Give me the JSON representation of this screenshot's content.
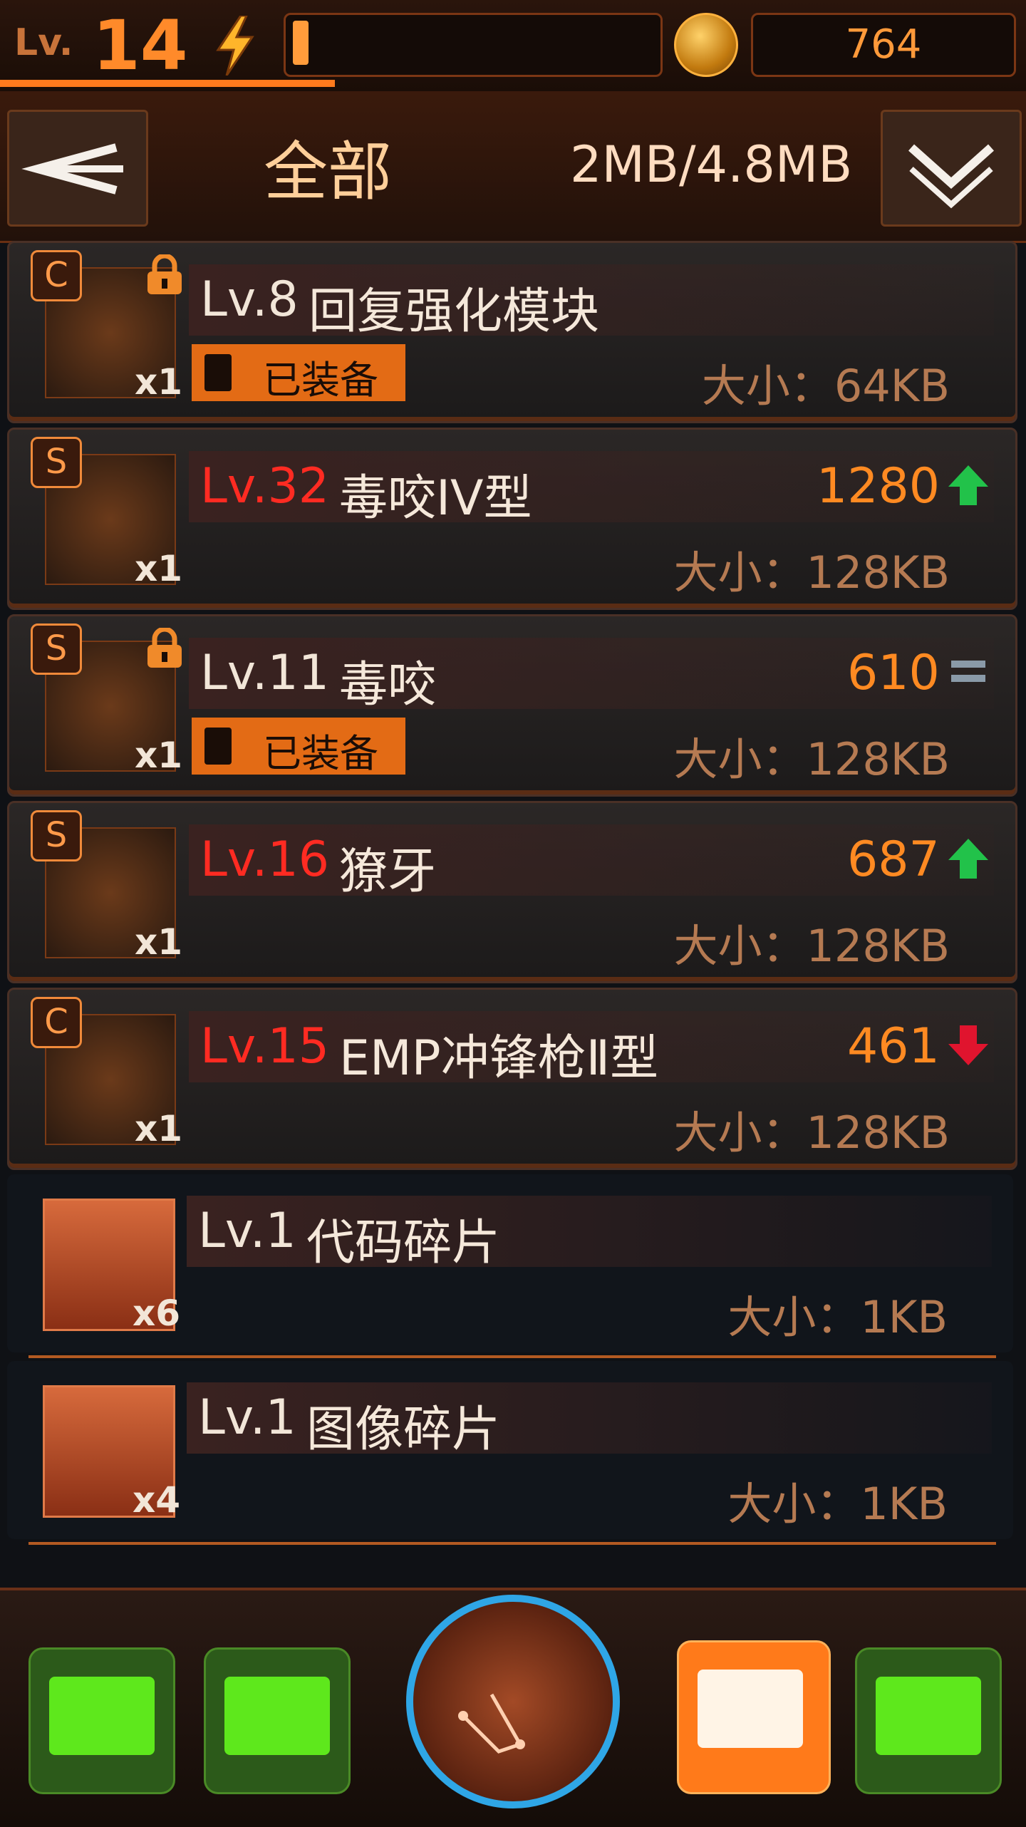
{
  "topbar": {
    "level_label": "Lv.",
    "level_value": "14",
    "energy_fraction": 0.04,
    "coins": "764"
  },
  "header": {
    "filter_title": "全部",
    "capacity": "2MB/4.8MB"
  },
  "items": [
    {
      "grade": "C",
      "locked": true,
      "qty": "x1",
      "level": "Lv.8",
      "level_red": false,
      "name": "回复强化模块",
      "power": "",
      "trend": "",
      "equipped_label": "已装备",
      "size": "大小：64KB"
    },
    {
      "grade": "S",
      "locked": false,
      "qty": "x1",
      "level": "Lv.32",
      "level_red": true,
      "name": "毒咬IV型",
      "power": "1280",
      "trend": "up",
      "equipped_label": "",
      "size": "大小：128KB"
    },
    {
      "grade": "S",
      "locked": true,
      "qty": "x1",
      "level": "Lv.11",
      "level_red": false,
      "name": "毒咬",
      "power": "610",
      "trend": "equal",
      "equipped_label": "已装备",
      "size": "大小：128KB"
    },
    {
      "grade": "S",
      "locked": false,
      "qty": "x1",
      "level": "Lv.16",
      "level_red": true,
      "name": "獠牙",
      "power": "687",
      "trend": "up",
      "equipped_label": "",
      "size": "大小：128KB"
    },
    {
      "grade": "C",
      "locked": false,
      "qty": "x1",
      "level": "Lv.15",
      "level_red": true,
      "name": "EMP冲锋枪Ⅱ型",
      "power": "461",
      "trend": "down",
      "equipped_label": "",
      "size": "大小：128KB"
    },
    {
      "grade": "",
      "locked": false,
      "qty": "x6",
      "level": "Lv.1",
      "level_red": false,
      "name": "代码碎片",
      "power": "",
      "trend": "",
      "equipped_label": "",
      "size": "大小：1KB"
    },
    {
      "grade": "",
      "locked": false,
      "qty": "x4",
      "level": "Lv.1",
      "level_red": false,
      "name": "图像碎片",
      "power": "",
      "trend": "",
      "equipped_label": "",
      "size": "大小：1KB"
    }
  ],
  "nav": {
    "icons": [
      "chat-icon",
      "network-icon",
      "map-globe-icon",
      "chip-icon",
      "profile-card-icon"
    ],
    "active": "chip-icon"
  },
  "colors": {
    "accent": "#ff8a22",
    "level_red": "#ff2b22",
    "trend_up": "#22c24a",
    "trend_down": "#e0142e",
    "nav_green": "#5ee81c"
  }
}
